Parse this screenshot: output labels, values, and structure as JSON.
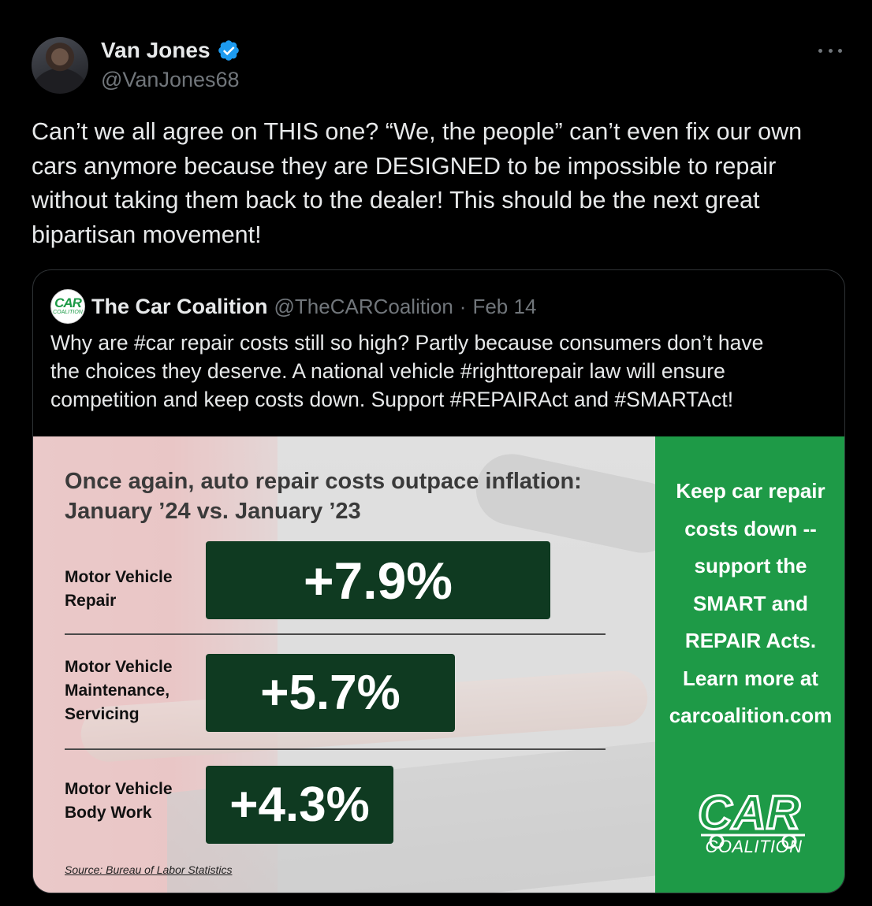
{
  "author": {
    "name": "Van Jones",
    "handle": "@VanJones68"
  },
  "tweet": {
    "text": "Can’t we all agree on THIS one? “We, the people” can’t even fix our own\ncars anymore because they are DESIGNED to be impossible to repair\nwithout taking them back to the dealer! This should be the next great\nbipartisan movement!"
  },
  "quote": {
    "name": "The Car Coalition",
    "handle": "@TheCARCoalition",
    "separator": "·",
    "date": "Feb 14",
    "text": "Why are #car repair costs still so high? Partly because consumers don’t have\nthe choices they deserve. A national vehicle #righttorepair law will ensure\ncompetition and keep costs down. Support #REPAIRAct and #SMARTAct!",
    "avatar_logo": {
      "big": "CAR",
      "small": "COALITION"
    }
  },
  "infographic": {
    "title": "Once again, auto repair costs outpace inflation:\nJanuary ’24 vs. January ’23",
    "rows": [
      {
        "label": "Motor Vehicle\nRepair",
        "value": "+7.9%"
      },
      {
        "label": "Motor Vehicle\nMaintenance,\nServicing",
        "value": "+5.7%"
      },
      {
        "label": "Motor Vehicle\nBody Work",
        "value": "+4.3%"
      }
    ],
    "source": "Source: Bureau of Labor Statistics",
    "side_text": "Keep car repair\ncosts down --\nsupport the\nSMART and\nREPAIR Acts.\nLearn more at\ncarcoalition.com",
    "logo_text": "CAR",
    "logo_sub": "COALITION"
  },
  "colors": {
    "background": "#000000",
    "text_primary": "#e7e9ea",
    "text_secondary": "#71767b",
    "verified": "#1d9bf0",
    "stat_box": "#0f3a21",
    "side_panel": "#1e9a47"
  },
  "icons": {
    "verified": "verified-badge-icon",
    "more": "more-options-icon"
  }
}
